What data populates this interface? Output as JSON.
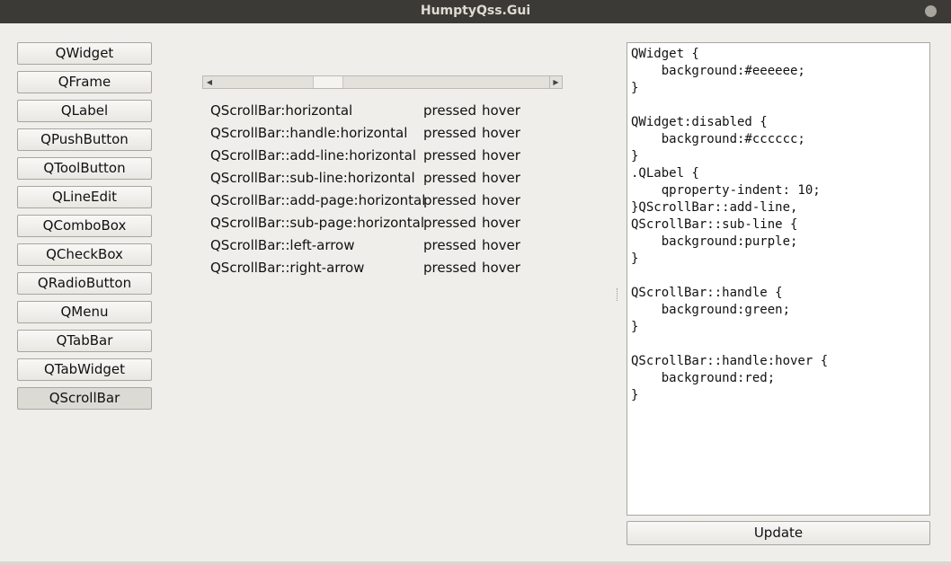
{
  "window": {
    "title": "HumptyQss.Gui"
  },
  "nav": {
    "items": [
      {
        "label": "QWidget"
      },
      {
        "label": "QFrame"
      },
      {
        "label": "QLabel"
      },
      {
        "label": "QPushButton"
      },
      {
        "label": "QToolButton"
      },
      {
        "label": "QLineEdit"
      },
      {
        "label": "QComboBox"
      },
      {
        "label": "QCheckBox"
      },
      {
        "label": "QRadioButton"
      },
      {
        "label": "QMenu"
      },
      {
        "label": "QTabBar"
      },
      {
        "label": "QTabWidget"
      },
      {
        "label": "QScrollBar"
      }
    ],
    "active": "QScrollBar"
  },
  "preview": {
    "scrollbar_position": 0.32,
    "selectors": [
      {
        "name": "QScrollBar:horizontal",
        "state1": "pressed",
        "state2": "hover"
      },
      {
        "name": "QScrollBar::handle:horizontal",
        "state1": "pressed",
        "state2": "hover"
      },
      {
        "name": "QScrollBar::add-line:horizontal",
        "state1": "pressed",
        "state2": "hover"
      },
      {
        "name": "QScrollBar::sub-line:horizontal",
        "state1": "pressed",
        "state2": "hover"
      },
      {
        "name": "QScrollBar::add-page:horizontal",
        "state1": "pressed",
        "state2": "hover"
      },
      {
        "name": "QScrollBar::sub-page:horizontal",
        "state1": "pressed",
        "state2": "hover"
      },
      {
        "name": "QScrollBar::left-arrow",
        "state1": "pressed",
        "state2": "hover"
      },
      {
        "name": "QScrollBar::right-arrow",
        "state1": "pressed",
        "state2": "hover"
      }
    ]
  },
  "editor": {
    "lines": [
      "QWidget {",
      "    background:#eeeeee;",
      "}",
      "",
      "QWidget:disabled {",
      "    background:#cccccc;",
      "}",
      ".QLabel {",
      "    qproperty-indent: 10;",
      "}QScrollBar::add-line,",
      "QScrollBar::sub-line {",
      "    background:purple;",
      "}",
      "",
      "QScrollBar::handle {",
      "    background:green;",
      "}",
      "",
      "QScrollBar::handle:hover {",
      "    background:red;",
      "}"
    ]
  },
  "update_label": "Update"
}
